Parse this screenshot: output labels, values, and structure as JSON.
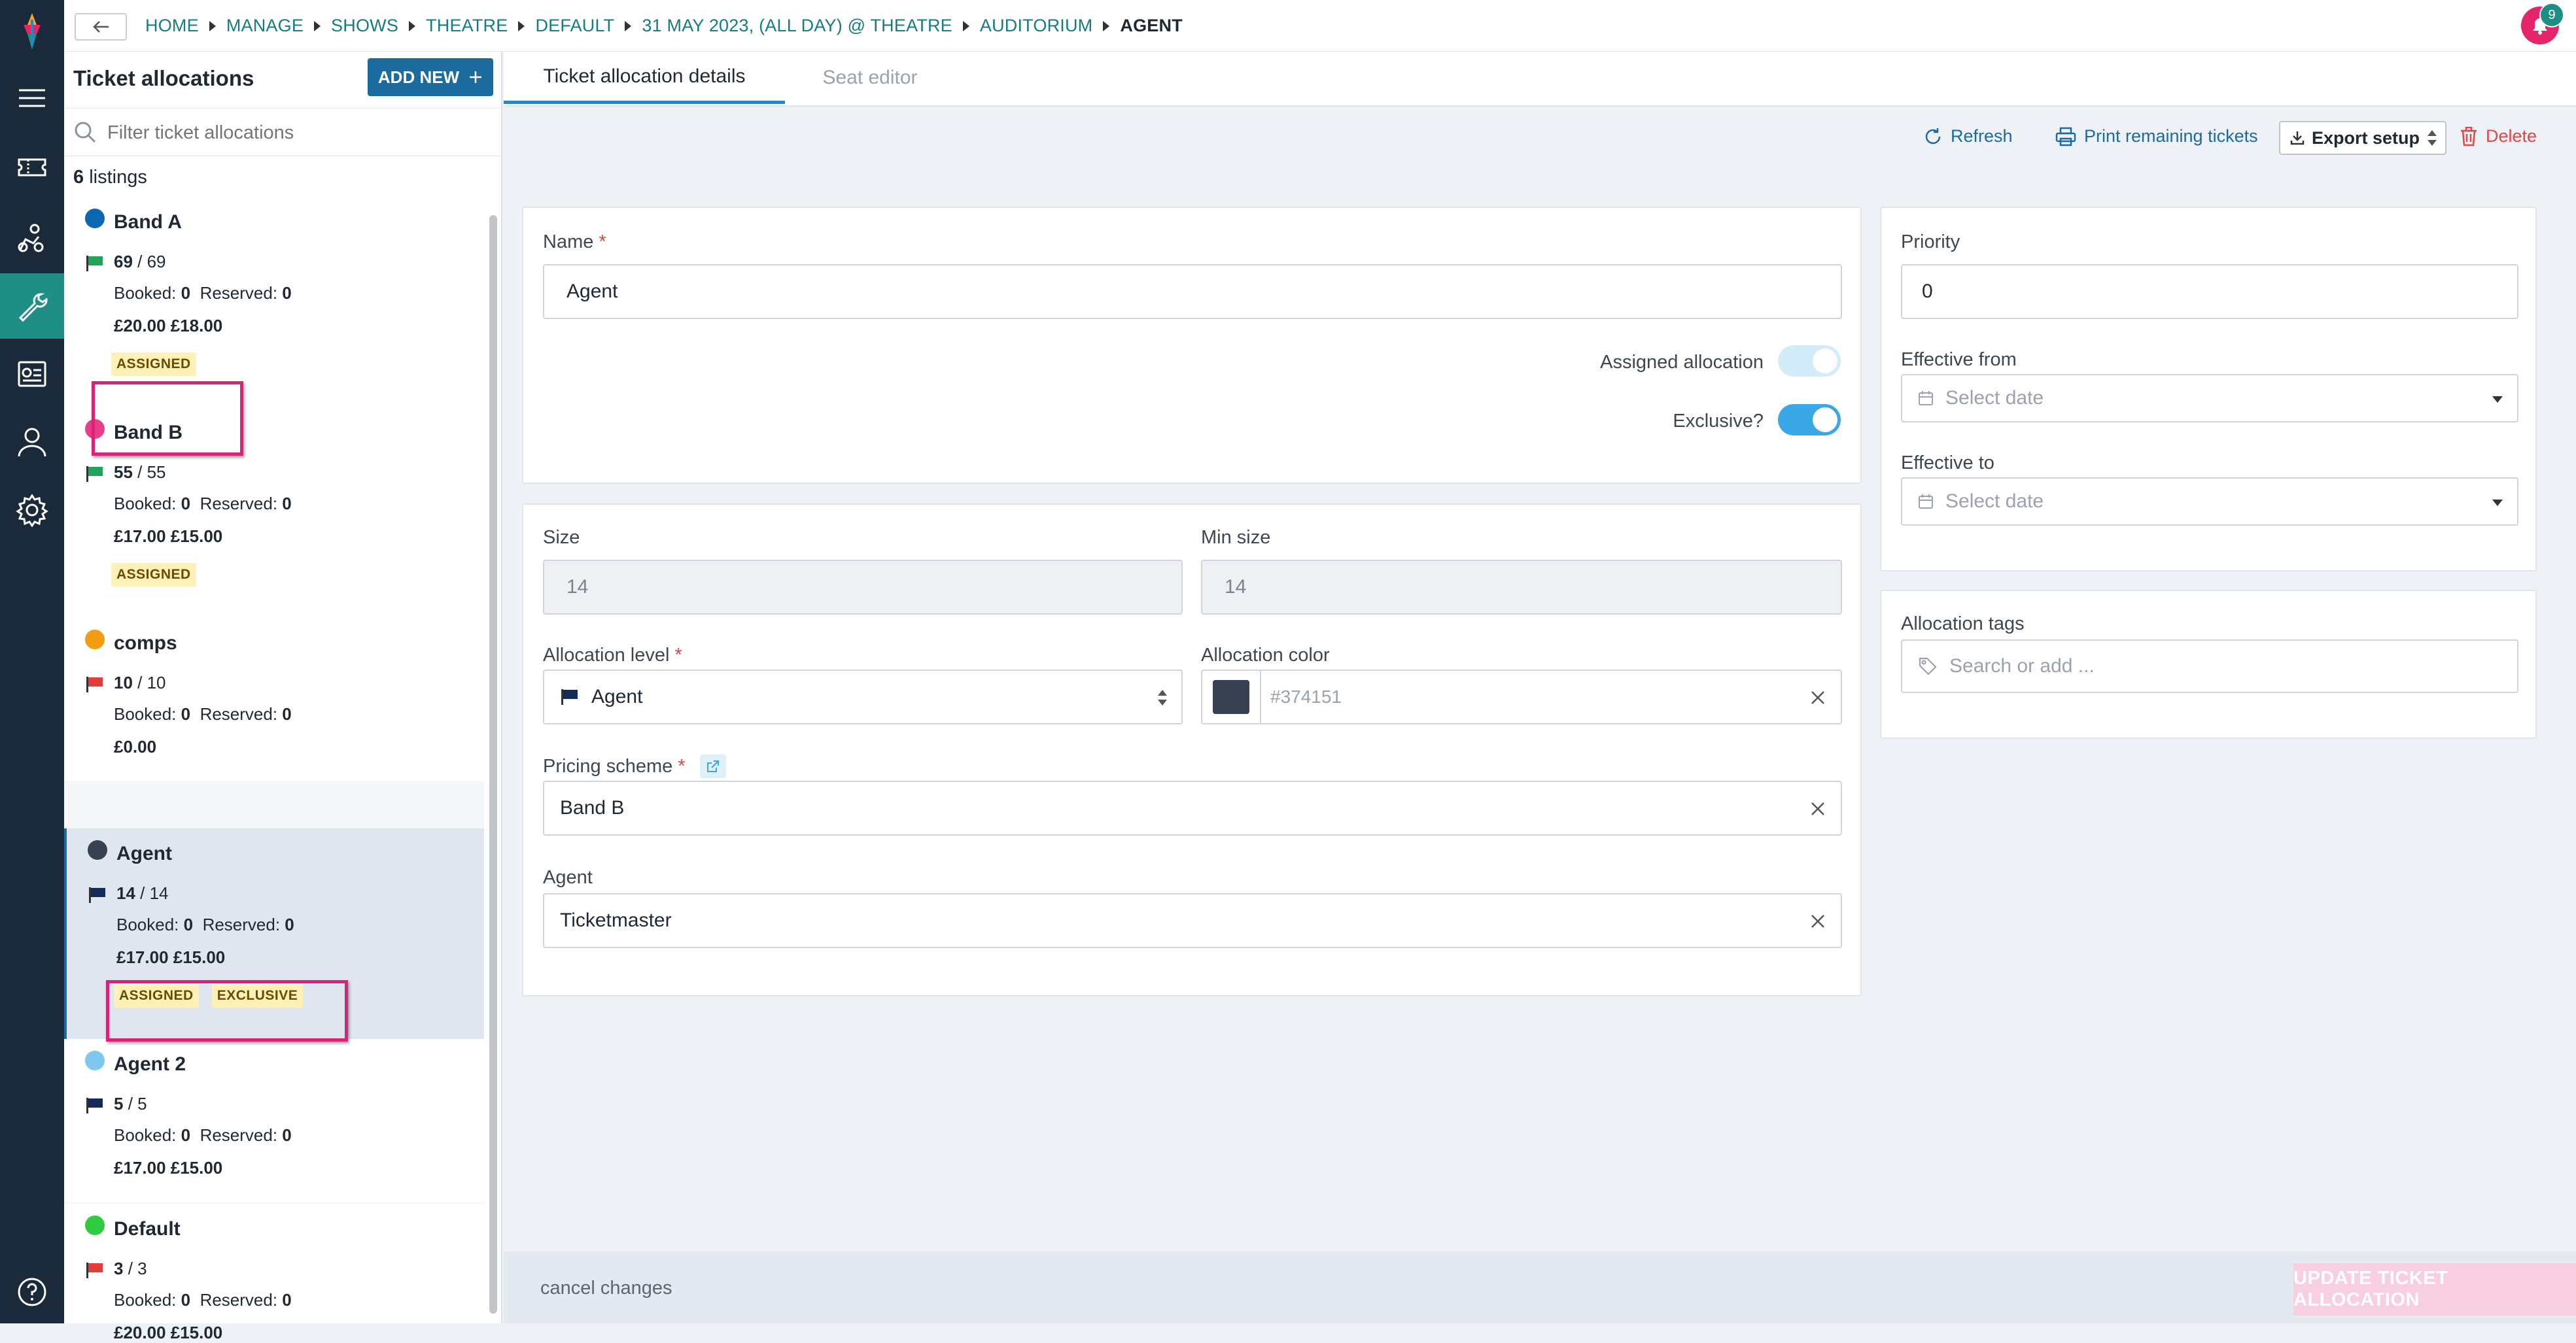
{
  "breadcrumb": {
    "items": [
      "HOME",
      "MANAGE",
      "SHOWS",
      "THEATRE",
      "DEFAULT",
      "31 MAY 2023, (ALL DAY) @ THEATRE",
      "AUDITORIUM"
    ],
    "current": "AGENT"
  },
  "notifications": {
    "count": "9"
  },
  "left_panel": {
    "title": "Ticket allocations",
    "add_new_label": "ADD NEW",
    "filter_placeholder": "Filter ticket allocations",
    "count_number": "6",
    "count_label": "listings"
  },
  "allocations": [
    {
      "name": "Band A",
      "color": "#0b67b2",
      "flag_color": "#21a35b",
      "available": "69",
      "total": "69",
      "booked_label": "Booked:",
      "booked": "0",
      "reserved_label": "Reserved:",
      "reserved": "0",
      "prices": "£20.00  £18.00",
      "badges": [
        "ASSIGNED"
      ]
    },
    {
      "name": "Band B",
      "color": "#e83e8c",
      "flag_color": "#21a35b",
      "available": "55",
      "total": "55",
      "booked_label": "Booked:",
      "booked": "0",
      "reserved_label": "Reserved:",
      "reserved": "0",
      "prices": "£17.00  £15.00",
      "badges": [
        "ASSIGNED"
      ]
    },
    {
      "name": "comps",
      "color": "#f39c12",
      "flag_color": "#e23d3d",
      "available": "10",
      "total": "10",
      "booked_label": "Booked:",
      "booked": "0",
      "reserved_label": "Reserved:",
      "reserved": "0",
      "prices": "£0.00",
      "badges": []
    },
    {
      "name": "Agent",
      "color": "#374151",
      "flag_color": "#142a57",
      "available": "14",
      "total": "14",
      "booked_label": "Booked:",
      "booked": "0",
      "reserved_label": "Reserved:",
      "reserved": "0",
      "prices": "£17.00  £15.00",
      "badges": [
        "ASSIGNED",
        "EXCLUSIVE"
      ]
    },
    {
      "name": "Agent 2",
      "color": "#7ec8f0",
      "flag_color": "#142a57",
      "available": "5",
      "total": "5",
      "booked_label": "Booked:",
      "booked": "0",
      "reserved_label": "Reserved:",
      "reserved": "0",
      "prices": "£17.00  £15.00",
      "badges": []
    },
    {
      "name": "Default",
      "color": "#2ecc40",
      "flag_color": "#e23d3d",
      "available": "3",
      "total": "3",
      "booked_label": "Booked:",
      "booked": "0",
      "reserved_label": "Reserved:",
      "reserved": "0",
      "prices": "£20.00  £15.00",
      "badges": []
    }
  ],
  "tabs": [
    {
      "label": "Ticket allocation details",
      "active": true
    },
    {
      "label": "Seat editor",
      "active": false
    }
  ],
  "toolbar": {
    "refresh_label": "Refresh",
    "print_label": "Print remaining tickets",
    "export_label": "Export setup",
    "delete_label": "Delete"
  },
  "form": {
    "name_label": "Name",
    "name_value": "Agent",
    "assigned_label": "Assigned allocation",
    "assigned_on": false,
    "exclusive_label": "Exclusive?",
    "exclusive_on": true,
    "size_label": "Size",
    "size_value": "14",
    "min_size_label": "Min size",
    "min_size_value": "14",
    "level_label": "Allocation level",
    "level_value": "Agent",
    "color_label": "Allocation color",
    "color_value": "#374151",
    "color_swatch": "#374151",
    "pricing_label": "Pricing scheme",
    "pricing_value": "Band B",
    "agent_label": "Agent",
    "agent_value": "Ticketmaster",
    "priority_label": "Priority",
    "priority_value": "0",
    "effective_from_label": "Effective from",
    "effective_from_placeholder": "Select date",
    "effective_to_label": "Effective to",
    "effective_to_placeholder": "Select date",
    "tags_label": "Allocation tags",
    "tags_placeholder": "Search or add ..."
  },
  "footer": {
    "cancel_label": "cancel changes",
    "update_label": "UPDATE TICKET ALLOCATION"
  },
  "colors": {
    "sidebar": "#1a2a3a",
    "accent": "#1f8f86",
    "link": "#167c7e",
    "primary_button": "#1b6b9f",
    "highlight": "#d7237a",
    "toggle_on": "#3aa7e6"
  }
}
